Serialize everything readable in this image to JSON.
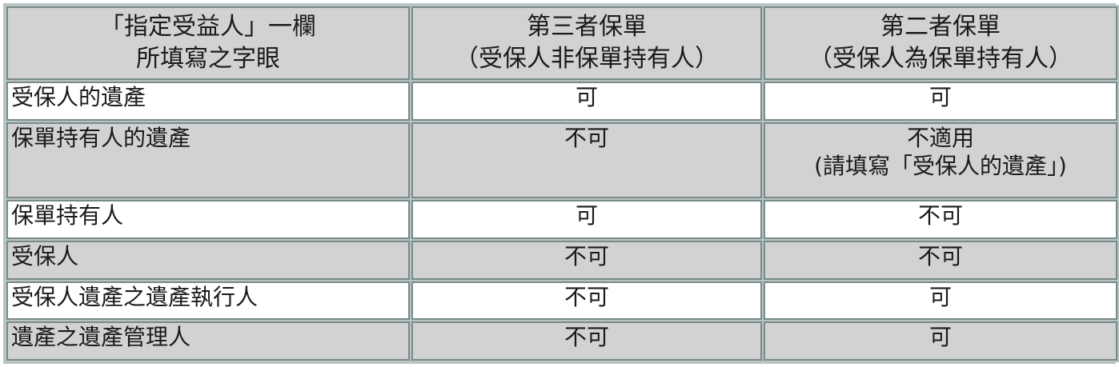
{
  "table": {
    "headers": [
      {
        "lines": [
          "「指定受益人」一欄",
          "所填寫之字眼"
        ]
      },
      {
        "lines": [
          "第三者保單",
          "（受保人非保單持有人）"
        ]
      },
      {
        "lines": [
          "第二者保單",
          "（受保人為保單持有人）"
        ]
      }
    ],
    "rows": [
      {
        "label": "受保人的遺產",
        "third": [
          "可"
        ],
        "second": [
          "可"
        ],
        "shade": false
      },
      {
        "label": "保單持有人的遺產",
        "third": [
          "不可"
        ],
        "second": [
          "不適用",
          "(請填寫「受保人的遺產」)"
        ],
        "shade": true
      },
      {
        "label": "保單持有人",
        "third": [
          "可"
        ],
        "second": [
          "不可"
        ],
        "shade": false
      },
      {
        "label": "受保人",
        "third": [
          "不可"
        ],
        "second": [
          "不可"
        ],
        "shade": true
      },
      {
        "label": "受保人遺產之遺產執行人",
        "third": [
          "不可"
        ],
        "second": [
          "可"
        ],
        "shade": false
      },
      {
        "label": "遺產之遺產管理人",
        "third": [
          "不可"
        ],
        "second": [
          "可"
        ],
        "shade": true
      }
    ]
  },
  "colors": {
    "shaded_row": "#d2d2d2",
    "plain_row": "#ffffff",
    "border": "#7a8a8a",
    "frame": "#b8c4c4"
  }
}
